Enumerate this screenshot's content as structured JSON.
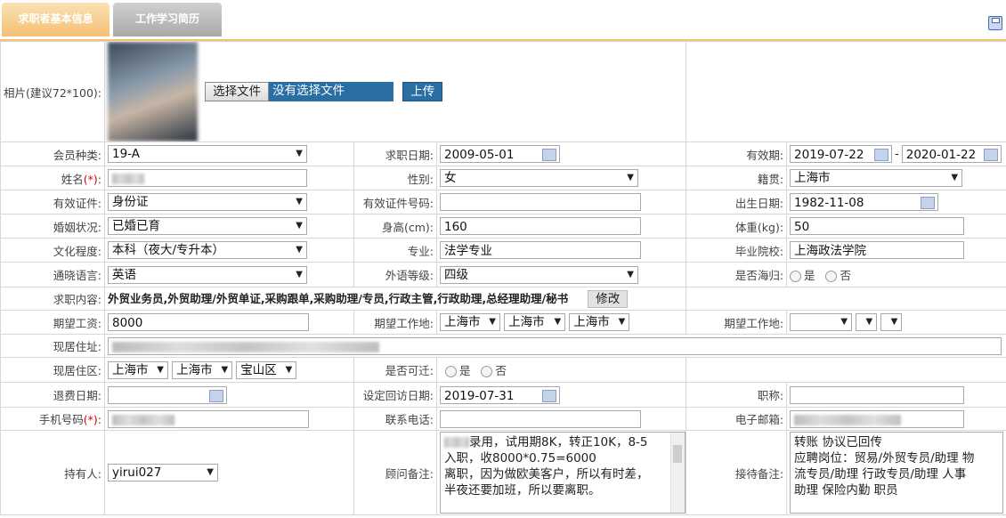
{
  "tabs": [
    {
      "label": "求职者基本信息"
    },
    {
      "label": "工作学习简历"
    }
  ],
  "photo": {
    "label": "相片(建议72*100):",
    "choose_file": "选择文件",
    "no_file": "没有选择文件",
    "upload": "上传"
  },
  "fields": {
    "member_type": {
      "label": "会员种类:",
      "value": "19-A"
    },
    "job_date": {
      "label": "求职日期:",
      "value": "2009-05-01"
    },
    "valid_period": {
      "label": "有效期:",
      "from": "2019-07-22",
      "sep": "-",
      "to": "2020-01-22"
    },
    "name": {
      "label": "姓名",
      "req": "(*)",
      "colon": ":"
    },
    "gender": {
      "label": "性别:",
      "value": "女"
    },
    "native_place": {
      "label": "籍贯:",
      "value": "上海市"
    },
    "id_type": {
      "label": "有效证件:",
      "value": "身份证"
    },
    "id_number": {
      "label": "有效证件号码:",
      "value": ""
    },
    "birth_date": {
      "label": "出生日期:",
      "value": "1982-11-08"
    },
    "marital": {
      "label": "婚姻状况:",
      "value": "已婚已育"
    },
    "height": {
      "label": "身高(cm):",
      "value": "160"
    },
    "weight": {
      "label": "体重(kg):",
      "value": "50"
    },
    "education": {
      "label": "文化程度:",
      "value": "本科（夜大/专升本）"
    },
    "major": {
      "label": "专业:",
      "value": "法学专业"
    },
    "school": {
      "label": "毕业院校:",
      "value": "上海政法学院"
    },
    "language": {
      "label": "通晓语言:",
      "value": "英语"
    },
    "lang_level": {
      "label": "外语等级:",
      "value": "四级"
    },
    "overseas": {
      "label": "是否海归:",
      "yes": "是",
      "no": "否"
    },
    "job_content": {
      "label": "求职内容:",
      "value": "外贸业务员,外贸助理/外贸单证,采购跟单,采购助理/专员,行政主管,行政助理,总经理助理/秘书",
      "edit": "修改"
    },
    "salary": {
      "label": "期望工资:",
      "value": "8000"
    },
    "work_place1": {
      "label": "期望工作地:",
      "v1": "上海市",
      "v2": "上海市",
      "v3": "上海市"
    },
    "work_place2": {
      "label": "期望工作地:"
    },
    "address": {
      "label": "现居住址:"
    },
    "district": {
      "label": "现居住区:",
      "v1": "上海市",
      "v2": "上海市",
      "v3": "宝山区"
    },
    "relocate": {
      "label": "是否可迁:",
      "yes": "是",
      "no": "否"
    },
    "refund_date": {
      "label": "退费日期:",
      "value": ""
    },
    "visit_date": {
      "label": "设定回访日期:",
      "value": "2019-07-31"
    },
    "title": {
      "label": "职称:",
      "value": ""
    },
    "mobile": {
      "label": "手机号码",
      "req": "(*)",
      "colon": ":"
    },
    "phone": {
      "label": "联系电话:",
      "value": ""
    },
    "email": {
      "label": "电子邮箱:"
    },
    "holder": {
      "label": "持有人:",
      "value": "yirui027"
    },
    "advisor_note": {
      "label": "顾问备注:",
      "line1": "录用，试用期8K，转正10K，8-5",
      "line2": "入职，收8000*0.75=6000",
      "line3": "离职，因为做欧美客户，所以有时差，",
      "line4": "半夜还要加班，所以要离职。"
    },
    "reception_note": {
      "label": "接待备注:",
      "line1": "转账  协议已回传",
      "line2": "应聘岗位：贸易/外贸专员/助理  物",
      "line3": "流专员/助理  行政专员/助理  人事",
      "line4": "助理  保险内勤  职员"
    }
  },
  "colors": {
    "tab_active": "#f4c073",
    "tab_inactive": "#a9a9a9",
    "upload_bg": "#2a6fa3"
  }
}
